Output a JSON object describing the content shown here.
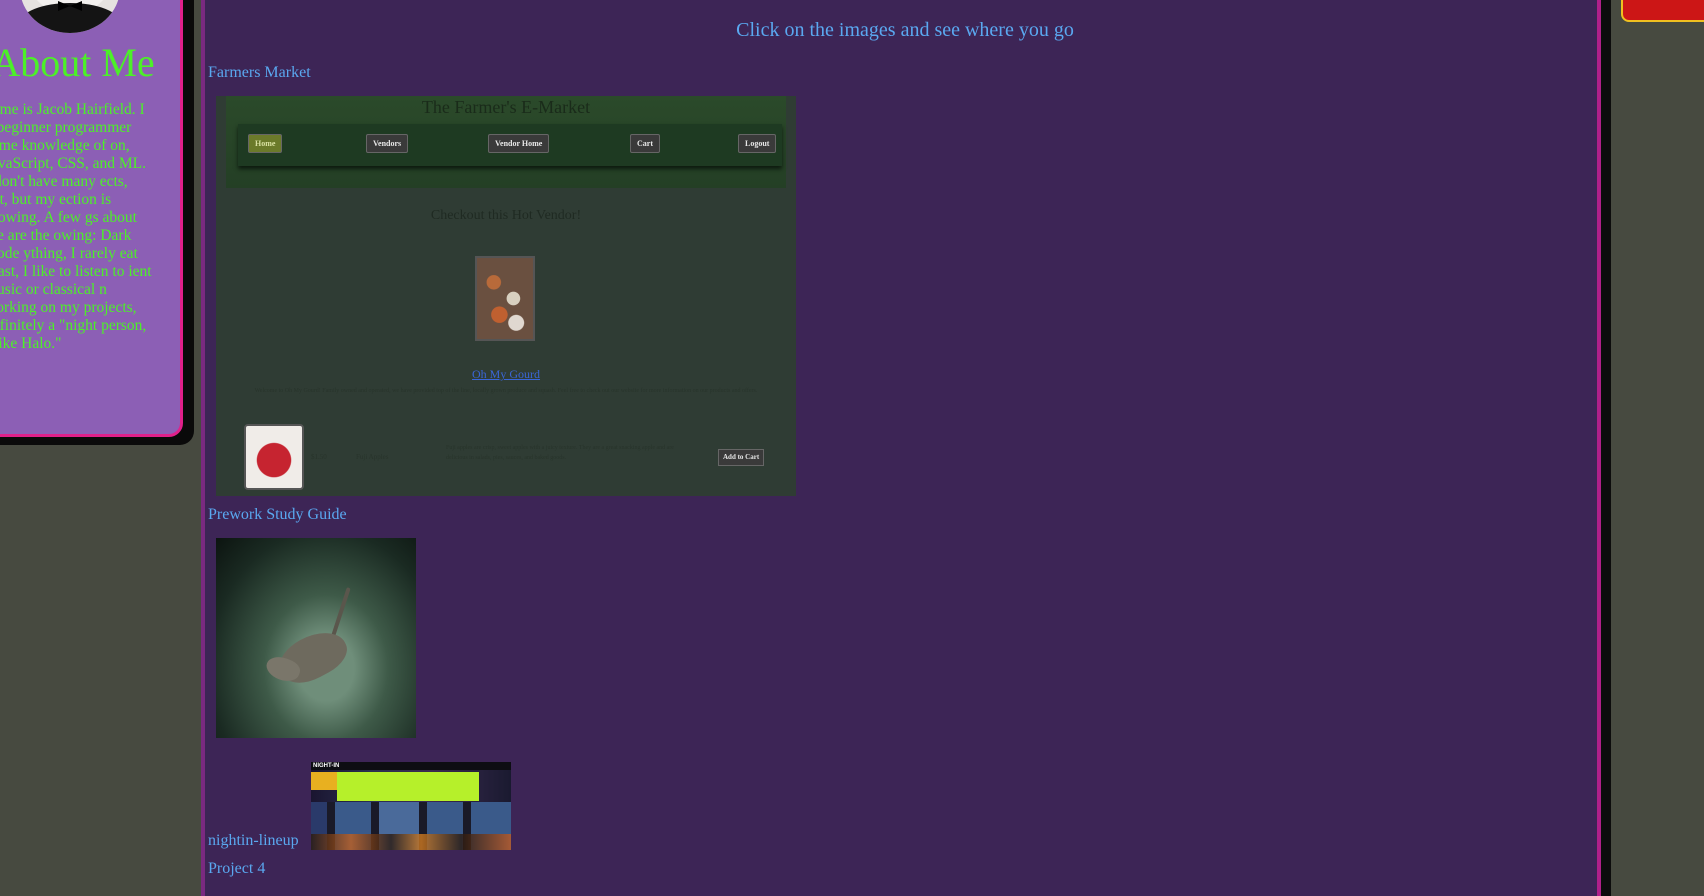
{
  "about": {
    "title": "About Me",
    "text": "name is Jacob Hairfield. I n beginner programmer some knowledge of on, JavaScript, CSS, and ML. I don't have many ects, yet, but my ection is growing. A few gs about me are the owing: Dark mode ything, I rarely eat kfast, I like to listen to ient music or classical n working on my projects, definitely a \"night person, I like Halo.\""
  },
  "main": {
    "heading": "Click on the images and see where you go",
    "projects": [
      {
        "label": "Farmers Market"
      },
      {
        "label": "Prework Study Guide"
      },
      {
        "label": "nightin-lineup"
      },
      {
        "label": "Project 4"
      }
    ]
  },
  "farmers_screenshot": {
    "title": "The Farmer's E-Market",
    "nav": [
      "Home",
      "Vendors",
      "Vendor Home",
      "Cart",
      "Logout"
    ],
    "hot_vendor_heading": "Checkout this Hot Vendor!",
    "vendor_name": "Oh My Gourd",
    "vendor_desc": "Welcome to Oh My Gourd! Family owned and operated, we have provided top of the line, locally grown produce and squash. Feel free to check out our website for more information on our products and offers.",
    "item_price": "$1.50",
    "item_name": "Fuji Apples",
    "item_desc": "Fuji apples are crisp, sweet apples with a juicy texture. They are a great snacking apple and are delicious in salads, pies, sauces, and baked goods.",
    "add_to_cart": "Add to Cart"
  },
  "nightin_screenshot": {
    "brand": "NIGHT-IN"
  },
  "colors": {
    "page_bg": "#474a40",
    "main_bg": "#3d2556",
    "about_bg": "#8c5fb5",
    "about_text": "#4cf028",
    "link": "#5aa8f0",
    "card_border": "#e0208a",
    "accent_red": "#cc1616"
  }
}
